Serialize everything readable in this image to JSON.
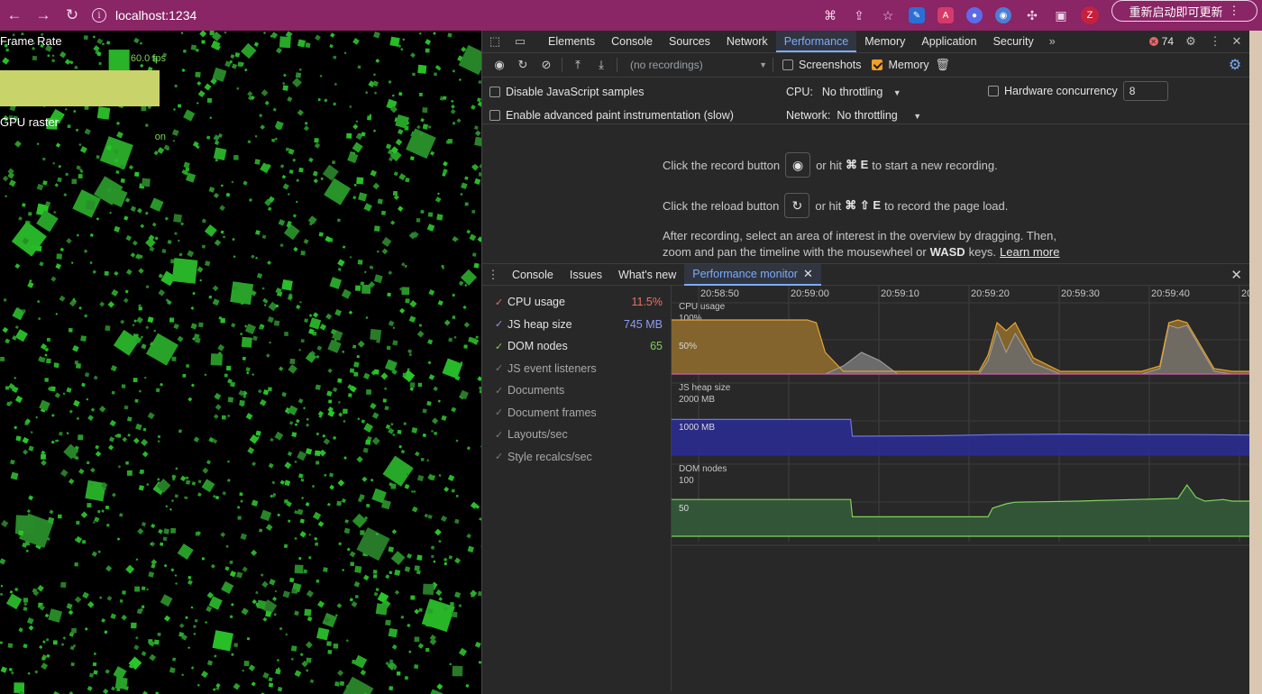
{
  "browser": {
    "url": "localhost:1234",
    "update_button": "重新启动即可更新",
    "profile_initial": "Z",
    "ext_badge": "A"
  },
  "page_stats": {
    "frame_rate_title": "Frame Rate",
    "frame_rate_value": "60.0 fps",
    "gpu_raster_title": "GPU raster",
    "gpu_raster_value": "on"
  },
  "devtools": {
    "tabs": [
      "Elements",
      "Console",
      "Sources",
      "Network",
      "Performance",
      "Memory",
      "Application",
      "Security"
    ],
    "more_tabs": "»",
    "error_count": "74",
    "recordings_placeholder": "(no recordings)",
    "screenshots_label": "Screenshots",
    "memory_label": "Memory",
    "settings": {
      "disable_js_samples": "Disable JavaScript samples",
      "advanced_paint": "Enable advanced paint instrumentation (slow)",
      "cpu_label": "CPU:",
      "cpu_value": "No throttling",
      "network_label": "Network:",
      "network_value": "No throttling",
      "hardware_concurrency_label": "Hardware concurrency",
      "hardware_concurrency_value": "8"
    },
    "landing": {
      "record_prefix": "Click the record button",
      "record_suffix_a": "or hit",
      "record_shortcut": "⌘ E",
      "record_suffix_b": "to start a new recording.",
      "reload_prefix": "Click the reload button",
      "reload_suffix_a": "or hit",
      "reload_shortcut": "⌘ ⇧ E",
      "reload_suffix_b": "to record the page load.",
      "after_line1": "After recording, select an area of interest in the overview by dragging. Then,",
      "after_line2a": "zoom and pan the timeline with the mousewheel or",
      "after_line2_keys": "WASD",
      "after_line2b": "keys.",
      "learn_more": "Learn more"
    },
    "drawer_tabs": [
      "Console",
      "Issues",
      "What's new",
      "Performance monitor"
    ],
    "monitor": {
      "metrics": [
        {
          "label": "CPU usage",
          "value": "11.5%",
          "checked": true,
          "color": "#e8716a"
        },
        {
          "label": "JS heap size",
          "value": "745 MB",
          "checked": true,
          "color": "#8e9cf5"
        },
        {
          "label": "DOM nodes",
          "value": "65",
          "checked": true,
          "color": "#7fd35a"
        },
        {
          "label": "JS event listeners",
          "value": "",
          "checked": false,
          "color": ""
        },
        {
          "label": "Documents",
          "value": "",
          "checked": false,
          "color": ""
        },
        {
          "label": "Document frames",
          "value": "",
          "checked": false,
          "color": ""
        },
        {
          "label": "Layouts/sec",
          "value": "",
          "checked": false,
          "color": ""
        },
        {
          "label": "Style recalcs/sec",
          "value": "",
          "checked": false,
          "color": ""
        }
      ],
      "time_ticks": [
        "20:58:50",
        "20:59:00",
        "20:59:10",
        "20:59:20",
        "20:59:30",
        "20:59:40",
        "20"
      ],
      "cpu_panel": {
        "title": "CPU usage",
        "label_top": "100%",
        "label_mid": "50%"
      },
      "heap_panel": {
        "title": "JS heap size",
        "label_top": "2000 MB",
        "label_mid": "1000 MB"
      },
      "dom_panel": {
        "title": "DOM nodes",
        "label_top": "100",
        "label_mid": "50"
      }
    }
  },
  "chart_data": [
    {
      "type": "area",
      "title": "CPU usage",
      "ylabel": "%",
      "ylim": [
        0,
        100
      ],
      "x": [
        0,
        5,
        10,
        12,
        14,
        15,
        16,
        17,
        19,
        21,
        23,
        25,
        28,
        32,
        34,
        35,
        36,
        37,
        38,
        40,
        43,
        48,
        52,
        54,
        55,
        56,
        57,
        60,
        62,
        64
      ],
      "values": [
        100,
        100,
        100,
        100,
        100,
        100,
        95,
        40,
        5,
        5,
        5,
        5,
        5,
        5,
        5,
        35,
        95,
        80,
        95,
        30,
        5,
        5,
        5,
        15,
        95,
        100,
        95,
        10,
        5,
        5
      ],
      "ghost": [
        0,
        0,
        0,
        0,
        0,
        0,
        0,
        0,
        15,
        40,
        25,
        0,
        0,
        0,
        0,
        25,
        80,
        40,
        75,
        20,
        0,
        0,
        0,
        10,
        90,
        85,
        90,
        5,
        0,
        0
      ]
    },
    {
      "type": "area",
      "title": "JS heap size",
      "ylabel": "MB",
      "ylim": [
        0,
        2000
      ],
      "x": [
        0,
        19.8,
        20,
        30,
        36,
        44,
        52,
        58,
        64
      ],
      "values": [
        1320,
        1320,
        700,
        720,
        760,
        780,
        760,
        760,
        745
      ]
    },
    {
      "type": "area",
      "title": "DOM nodes",
      "ylabel": "nodes",
      "ylim": [
        0,
        100
      ],
      "x": [
        0,
        19.8,
        20,
        35,
        35.5,
        37,
        38,
        45,
        47,
        56,
        57,
        58,
        59,
        61,
        62,
        64
      ],
      "values": [
        68,
        68,
        36,
        36,
        52,
        60,
        63,
        65,
        66,
        70,
        95,
        72,
        65,
        68,
        65,
        65
      ]
    }
  ]
}
